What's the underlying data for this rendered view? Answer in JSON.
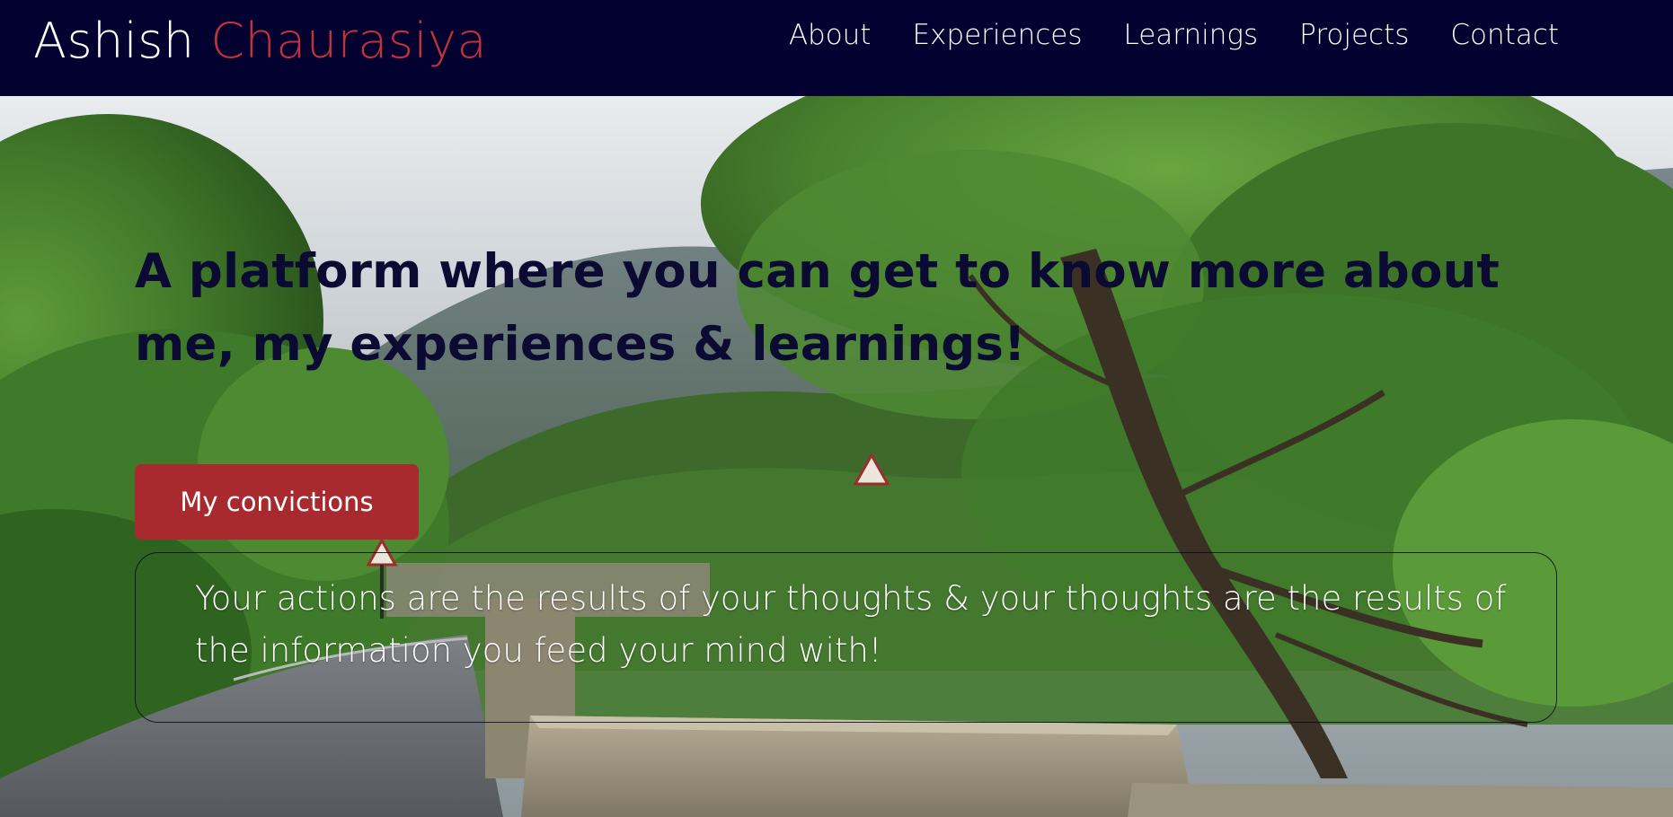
{
  "header": {
    "brand_first": "Ashish",
    "brand_last": "Chaurasiya",
    "nav": [
      "About",
      "Experiences",
      "Learnings",
      "Projects",
      "Contact"
    ]
  },
  "hero": {
    "headline": "A platform where you can get to know more about me, my experiences & learnings!",
    "cta_label": "My convictions",
    "quote": "Your actions are the results of your thoughts & your thoughts are the results of the information you feed your mind with!"
  },
  "colors": {
    "header_bg": "#02012f",
    "accent": "#a8292e",
    "brand_accent": "#c0333b",
    "headline": "#0b0a32"
  }
}
